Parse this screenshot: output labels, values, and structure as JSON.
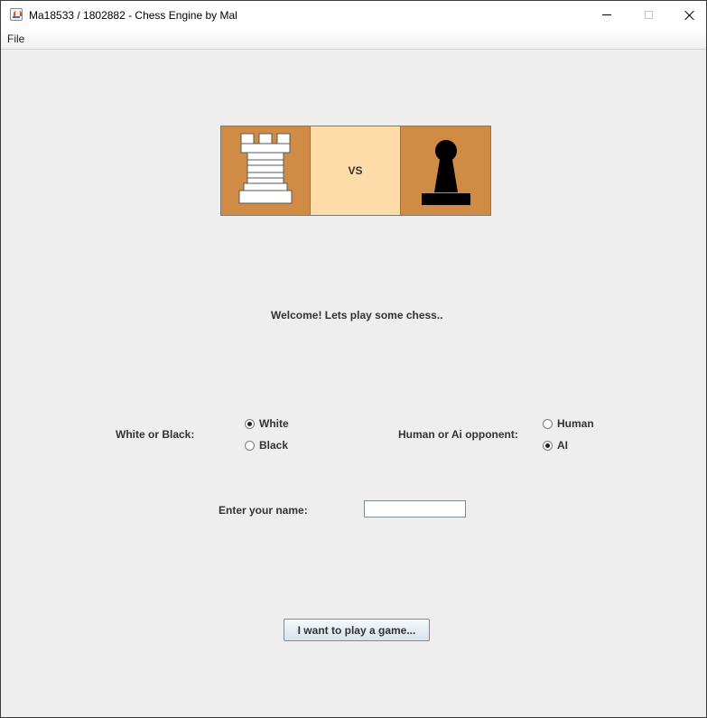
{
  "window": {
    "title": "Ma18533 / 1802882 - Chess Engine by Mal"
  },
  "menu": {
    "file_label": "File"
  },
  "banner": {
    "left_piece": "white-rook",
    "vs_label": "VS",
    "right_piece": "black-pawn",
    "colors": {
      "dark_square": "#d08b44",
      "light_square": "#fddcaa"
    }
  },
  "welcome_text": "Welcome! Lets play some chess..",
  "color_choice": {
    "label": "White or Black:",
    "options": [
      {
        "label": "White",
        "selected": true
      },
      {
        "label": "Black",
        "selected": false
      }
    ]
  },
  "opponent_choice": {
    "label": "Human or Ai opponent:",
    "options": [
      {
        "label": "Human",
        "selected": false
      },
      {
        "label": "AI",
        "selected": true
      }
    ]
  },
  "name_entry": {
    "label": "Enter your name:",
    "value": "",
    "placeholder": ""
  },
  "play_button": {
    "label": "I want to play a game..."
  }
}
